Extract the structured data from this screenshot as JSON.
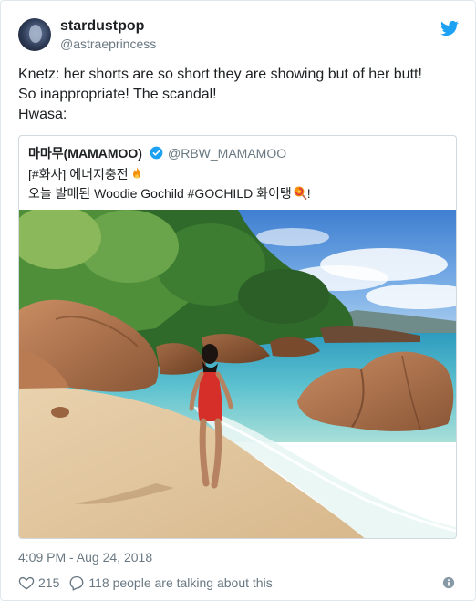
{
  "author": {
    "display_name": "stardustpop",
    "handle": "@astraeprincess"
  },
  "tweet": {
    "lines": [
      "Knetz: her shorts are so short they are showing but of her butt!",
      "So inappropriate! The scandal!",
      "Hwasa:"
    ]
  },
  "quoted": {
    "display_name": "마마무(MAMAMOO)",
    "handle": "@RBW_MAMAMOO",
    "line1": "[#화사] 에너지충전",
    "line2_prefix": "오늘 발매된 Woodie Gochild #GOCHILD 화이탱",
    "line2_suffix": "!",
    "icons": [
      "verified-badge-icon",
      "fire-emoji-icon",
      "lollipop-emoji-icon"
    ]
  },
  "footer": {
    "timestamp": "4:09 PM - Aug 24, 2018",
    "likes": "215",
    "talking": "118 people are talking about this"
  },
  "colors": {
    "twitter_blue": "#1da1f2",
    "secondary_text": "#697882",
    "border": "#e1e8ed"
  }
}
